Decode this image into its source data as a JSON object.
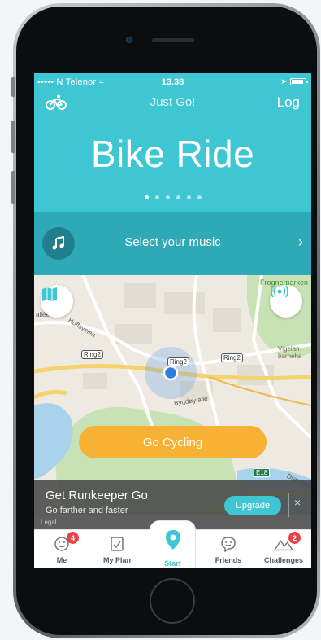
{
  "status_bar": {
    "carrier": "••••• N Telenor",
    "time": "13.38"
  },
  "nav": {
    "title": "Just Go!",
    "log_label": "Log",
    "left_icon": "bike-icon"
  },
  "hero": {
    "activity": "Bike Ride",
    "page_count": 6,
    "active_page": 1
  },
  "music": {
    "label": "Select your music",
    "icon": "music-note-icon"
  },
  "map": {
    "place_labels": [
      "Frognerparken",
      "Vigelan barneha",
      "Bygdøy allé",
      "Hoffsveien",
      "alléen"
    ],
    "road_shields": [
      "Ring2",
      "Ring2",
      "Ring2"
    ],
    "highway_shield": "E18",
    "drammens": "Dramme",
    "go_button": "Go Cycling"
  },
  "promo": {
    "title": "Get Runkeeper Go",
    "subtitle": "Go farther and faster",
    "legal": "Legal",
    "upgrade_label": "Upgrade",
    "close_label": "×"
  },
  "tabs": [
    {
      "label": "Me",
      "badge": "4",
      "icon": "smiley-icon"
    },
    {
      "label": "My Plan",
      "badge": "",
      "icon": "checklist-icon"
    },
    {
      "label": "Start",
      "badge": "",
      "icon": "location-pin-icon"
    },
    {
      "label": "Friends",
      "badge": "",
      "icon": "friends-icon"
    },
    {
      "label": "Challenges",
      "badge": "2",
      "icon": "mountains-icon"
    }
  ],
  "colors": {
    "accent": "#3fc6d3",
    "accent_dark": "#2ea9b8",
    "go_button": "#f7b134",
    "badge": "#e8434a"
  }
}
